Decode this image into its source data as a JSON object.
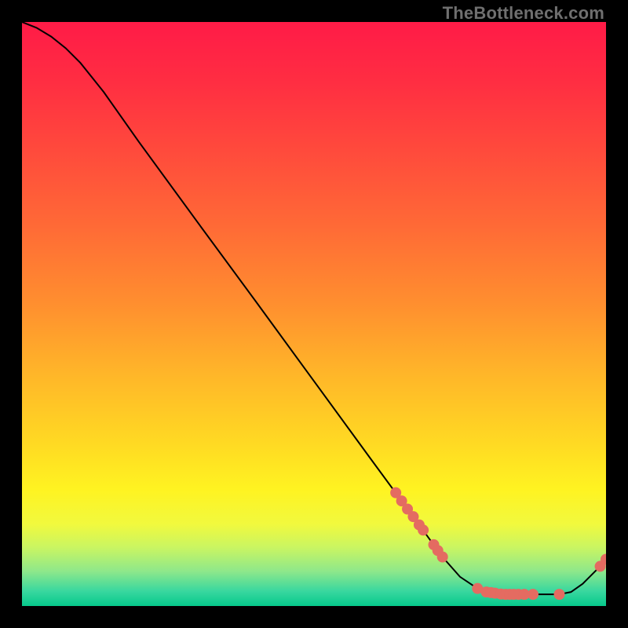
{
  "watermark": "TheBottleneck.com",
  "chart_data": {
    "type": "line",
    "title": "",
    "xlabel": "",
    "ylabel": "",
    "xlim": [
      0,
      100
    ],
    "ylim": [
      0,
      100
    ],
    "grid": false,
    "legend": false,
    "gradient_stops": [
      {
        "offset": 0.0,
        "color": "#ff1b47"
      },
      {
        "offset": 0.1,
        "color": "#ff2d42"
      },
      {
        "offset": 0.22,
        "color": "#ff4a3c"
      },
      {
        "offset": 0.35,
        "color": "#ff6a36"
      },
      {
        "offset": 0.48,
        "color": "#ff8e2f"
      },
      {
        "offset": 0.6,
        "color": "#ffb529"
      },
      {
        "offset": 0.72,
        "color": "#ffd923"
      },
      {
        "offset": 0.8,
        "color": "#fff321"
      },
      {
        "offset": 0.86,
        "color": "#f1f93e"
      },
      {
        "offset": 0.9,
        "color": "#c9f562"
      },
      {
        "offset": 0.94,
        "color": "#8fe88a"
      },
      {
        "offset": 0.975,
        "color": "#38d79f"
      },
      {
        "offset": 1.0,
        "color": "#06c98b"
      }
    ],
    "curve": [
      {
        "x": 0.0,
        "y": 100.0
      },
      {
        "x": 2.5,
        "y": 99.0
      },
      {
        "x": 5.0,
        "y": 97.5
      },
      {
        "x": 7.5,
        "y": 95.5
      },
      {
        "x": 10.0,
        "y": 93.0
      },
      {
        "x": 12.0,
        "y": 90.5
      },
      {
        "x": 14.0,
        "y": 88.0
      },
      {
        "x": 20.0,
        "y": 79.5
      },
      {
        "x": 30.0,
        "y": 65.8
      },
      {
        "x": 40.0,
        "y": 52.2
      },
      {
        "x": 50.0,
        "y": 38.5
      },
      {
        "x": 60.0,
        "y": 24.8
      },
      {
        "x": 65.0,
        "y": 18.0
      },
      {
        "x": 68.0,
        "y": 13.9
      },
      {
        "x": 72.0,
        "y": 8.4
      },
      {
        "x": 75.0,
        "y": 5.0
      },
      {
        "x": 78.0,
        "y": 3.0
      },
      {
        "x": 80.0,
        "y": 2.3
      },
      {
        "x": 83.0,
        "y": 2.0
      },
      {
        "x": 88.0,
        "y": 2.0
      },
      {
        "x": 92.0,
        "y": 2.0
      },
      {
        "x": 94.0,
        "y": 2.4
      },
      {
        "x": 96.0,
        "y": 3.8
      },
      {
        "x": 98.0,
        "y": 5.8
      },
      {
        "x": 99.0,
        "y": 6.8
      },
      {
        "x": 100.0,
        "y": 8.0
      }
    ],
    "markers": [
      {
        "x": 64.0,
        "y": 19.4
      },
      {
        "x": 65.0,
        "y": 18.0
      },
      {
        "x": 66.0,
        "y": 16.6
      },
      {
        "x": 67.0,
        "y": 15.3
      },
      {
        "x": 68.0,
        "y": 13.9
      },
      {
        "x": 68.7,
        "y": 13.0
      },
      {
        "x": 70.5,
        "y": 10.5
      },
      {
        "x": 71.2,
        "y": 9.5
      },
      {
        "x": 72.0,
        "y": 8.4
      },
      {
        "x": 78.0,
        "y": 3.0
      },
      {
        "x": 79.5,
        "y": 2.4
      },
      {
        "x": 80.3,
        "y": 2.3
      },
      {
        "x": 81.0,
        "y": 2.2
      },
      {
        "x": 82.0,
        "y": 2.05
      },
      {
        "x": 82.8,
        "y": 2.0
      },
      {
        "x": 83.5,
        "y": 2.0
      },
      {
        "x": 84.2,
        "y": 2.0
      },
      {
        "x": 85.0,
        "y": 2.0
      },
      {
        "x": 86.0,
        "y": 2.0
      },
      {
        "x": 87.5,
        "y": 2.0
      },
      {
        "x": 92.0,
        "y": 2.0
      },
      {
        "x": 99.0,
        "y": 6.8
      },
      {
        "x": 100.0,
        "y": 8.0
      }
    ],
    "marker_color": "#e46b61",
    "curve_color": "#000000"
  }
}
